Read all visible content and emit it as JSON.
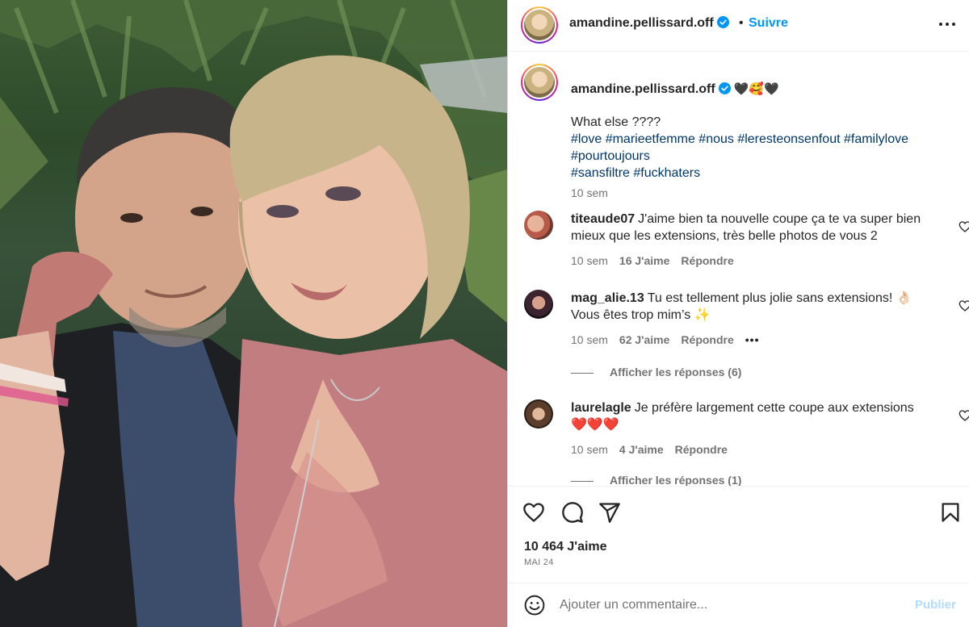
{
  "post": {
    "username": "amandine.pellissard.off",
    "follow_label": "Suivre",
    "separator": "•",
    "caption_emojis": "🖤🥰🖤",
    "caption_line1": "What else ????",
    "hashtags_line1": "#love #marieetfemme #nous #leresteonsenfout #familylove",
    "hashtags_line2": "#pourtoujours",
    "hashtags_line3": "#sansfiltre #fuckhaters",
    "caption_time": "10 sem"
  },
  "comments": [
    {
      "user": "titeaude07",
      "text": "J'aime bien ta nouvelle coupe ça te va super bien mieux que les extensions, très belle photos de vous 2",
      "time": "10 sem",
      "likes": "16 J'aime",
      "reply_label": "Répondre"
    },
    {
      "user": "mag_alie.13",
      "text": "Tu est tellement plus jolie sans extensions! 👌🏻 Vous êtes trop mim’s ✨",
      "time": "10 sem",
      "likes": "62 J'aime",
      "reply_label": "Répondre",
      "more": "•••",
      "view_replies": "Afficher les réponses (6)"
    },
    {
      "user": "laurelagle",
      "text": "Je préfère largement cette coupe aux extensions ❤️❤️❤️",
      "time": "10 sem",
      "likes": "4 J'aime",
      "reply_label": "Répondre",
      "view_replies": "Afficher les réponses (1)"
    }
  ],
  "stats": {
    "likes": "10 464 J'aime",
    "date": "MAI 24"
  },
  "composer": {
    "placeholder": "Ajouter un commentaire...",
    "publish_label": "Publier"
  },
  "icons": {
    "verified": "verified-badge-icon",
    "more": "more-horizontal-icon",
    "like": "heart-icon",
    "comment": "comment-icon",
    "share": "send-icon",
    "save": "bookmark-icon",
    "emoji": "emoji-icon"
  },
  "colors": {
    "accent": "#0095f6",
    "hashtag": "#00376b",
    "muted": "#737373",
    "verified": "#0095f6"
  }
}
